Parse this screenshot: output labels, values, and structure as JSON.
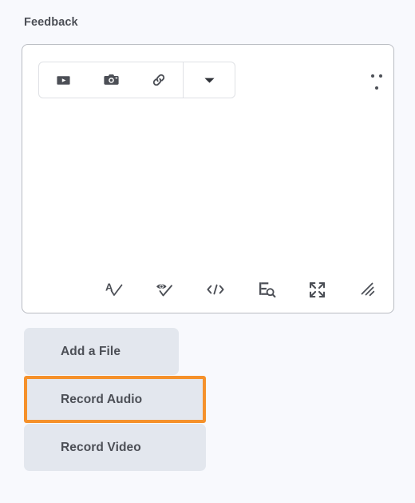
{
  "section": {
    "label": "Feedback"
  },
  "editor": {
    "toolbar": {
      "items": [
        {
          "name": "insert-video-icon",
          "title": "Insert Video"
        },
        {
          "name": "insert-image-icon",
          "title": "Insert Image"
        },
        {
          "name": "insert-link-icon",
          "title": "Insert Link"
        },
        {
          "name": "chevron-down-icon",
          "title": "More Insert Options"
        }
      ],
      "more_label": "More options"
    },
    "body": {
      "content": "",
      "placeholder": ""
    },
    "status_bar": {
      "items": [
        {
          "name": "spell-check-icon",
          "title": "Check Spelling"
        },
        {
          "name": "accessibility-check-icon",
          "title": "Accessibility Checker"
        },
        {
          "name": "html-source-icon",
          "title": "HTML Editor"
        },
        {
          "name": "word-count-icon",
          "title": "Word Count"
        },
        {
          "name": "fullscreen-icon",
          "title": "Fullscreen"
        },
        {
          "name": "resize-handle-icon",
          "title": "Resize"
        }
      ]
    }
  },
  "actions": {
    "add_file_label": "Add a File",
    "record_audio_label": "Record Audio",
    "record_video_label": "Record Video"
  },
  "colors": {
    "page_background": "#f8f9fd",
    "editor_background": "#ffffff",
    "editor_border": "#b9bcc2",
    "toolbar_border": "#dfe1e5",
    "icon": "#4c4f56",
    "text": "#4c4f56",
    "button_background": "#e3e7ee",
    "highlight": "#f5912b"
  }
}
